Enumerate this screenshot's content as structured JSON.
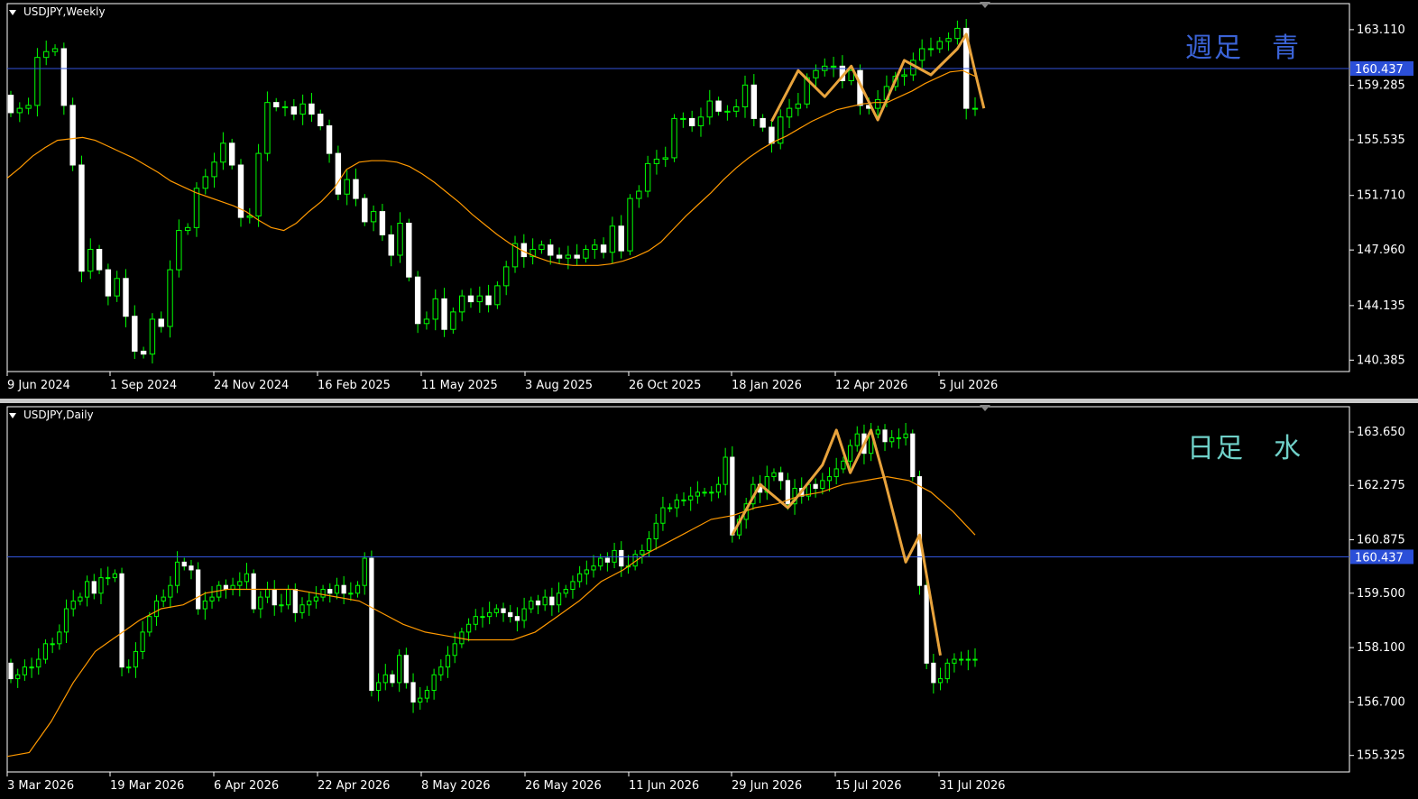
{
  "colors": {
    "background": "#000000",
    "grid_frame": "#ffffff",
    "candle_bull": "#00ff00",
    "candle_bear": "#ffffff",
    "ma": "#ff9900",
    "hline": "#3355dd",
    "pattern": "#e8a33c",
    "label_weekly": "#3b63d6",
    "label_daily": "#6fd0c8"
  },
  "weekly": {
    "title": "USDJPY,Weekly",
    "annotation": "週足　青",
    "hline_label": "160.437",
    "x_labels": [
      "9 Jun 2024",
      "1 Sep 2024",
      "24 Nov 2024",
      "16 Feb 2025",
      "11 May 2025",
      "3 Aug 2025",
      "26 Oct 2025",
      "18 Jan 2026",
      "12 Apr 2026",
      "5 Jul 2026"
    ],
    "y_labels": [
      "163.110",
      "159.285",
      "155.535",
      "151.710",
      "147.960",
      "144.135",
      "140.385"
    ]
  },
  "daily": {
    "title": "USDJPY,Daily",
    "annotation": "日足　水",
    "hline_label": "160.437",
    "x_labels": [
      "3 Mar 2026",
      "19 Mar 2026",
      "6 Apr 2026",
      "22 Apr 2026",
      "8 May 2026",
      "26 May 2026",
      "11 Jun 2026",
      "29 Jun 2026",
      "15 Jul 2026",
      "31 Jul 2026"
    ],
    "y_labels": [
      "163.650",
      "162.275",
      "160.875",
      "159.500",
      "158.100",
      "156.700",
      "155.325"
    ]
  },
  "chart_data": [
    {
      "type": "candlestick",
      "title": "USDJPY,Weekly",
      "ylim": [
        139.6,
        164.9
      ],
      "hline": 160.437,
      "x_start": "9 Jun 2024",
      "x_end": "5 Jul 2026",
      "close": [
        157.4,
        157.7,
        157.9,
        161.2,
        161.6,
        161.8,
        157.9,
        153.8,
        146.5,
        148.0,
        146.6,
        144.8,
        146.0,
        143.4,
        141.0,
        140.8,
        143.2,
        142.7,
        146.6,
        149.3,
        149.5,
        152.2,
        153.0,
        154.0,
        155.3,
        153.8,
        150.2,
        150.3,
        154.6,
        158.1,
        157.8,
        157.8,
        157.3,
        158.0,
        157.3,
        156.5,
        154.6,
        151.8,
        152.8,
        151.5,
        149.9,
        150.6,
        149.0,
        147.6,
        149.8,
        146.1,
        142.9,
        143.2,
        144.6,
        142.5,
        143.7,
        144.8,
        144.4,
        144.8,
        144.2,
        145.5,
        146.8,
        148.4,
        147.5,
        148.0,
        148.3,
        147.6,
        147.4,
        147.6,
        147.4,
        148.0,
        148.3,
        147.8,
        149.6,
        147.9,
        151.5,
        152.0,
        153.9,
        154.2,
        154.3,
        157.0,
        157.0,
        156.5,
        157.1,
        158.2,
        157.5,
        157.5,
        157.8,
        159.3,
        157.0,
        156.4,
        155.3,
        157.1,
        157.7,
        158.0,
        159.8,
        160.3,
        160.6,
        160.6,
        159.6,
        160.3,
        157.9,
        157.7,
        158.3,
        159.2,
        159.9,
        160.0,
        161.0,
        161.8,
        161.8,
        162.3,
        162.5,
        163.2,
        157.7,
        157.7
      ],
      "open": [
        158.6,
        157.4,
        157.7,
        157.9,
        161.2,
        161.6,
        161.8,
        157.9,
        153.8,
        146.5,
        148.0,
        146.6,
        144.8,
        146.0,
        143.4,
        141.0,
        140.8,
        143.2,
        142.7,
        146.6,
        149.3,
        149.5,
        152.2,
        153.0,
        154.0,
        155.3,
        153.8,
        150.2,
        150.3,
        154.6,
        158.1,
        157.8,
        157.8,
        157.3,
        158.0,
        157.3,
        156.5,
        154.6,
        151.8,
        152.8,
        151.5,
        149.9,
        150.6,
        149.0,
        147.6,
        149.8,
        146.1,
        142.9,
        143.2,
        144.6,
        142.5,
        143.7,
        144.8,
        144.4,
        144.8,
        144.2,
        145.5,
        146.8,
        148.4,
        147.5,
        148.0,
        148.3,
        147.6,
        147.4,
        147.6,
        147.4,
        148.0,
        148.3,
        147.8,
        149.6,
        147.9,
        151.5,
        152.0,
        153.9,
        154.2,
        154.3,
        157.0,
        157.0,
        156.5,
        157.1,
        158.2,
        157.5,
        157.5,
        157.8,
        159.3,
        157.0,
        156.4,
        155.3,
        157.1,
        157.7,
        158.0,
        159.8,
        160.3,
        160.6,
        160.6,
        159.6,
        160.3,
        157.9,
        157.7,
        158.3,
        159.2,
        159.9,
        160.0,
        161.0,
        161.8,
        161.8,
        162.3,
        162.5,
        163.2,
        157.7
      ],
      "ma": [
        152.9,
        153.6,
        154.4,
        155.0,
        155.5,
        155.6,
        155.7,
        155.5,
        155.1,
        154.7,
        154.3,
        153.8,
        153.3,
        152.7,
        152.3,
        151.9,
        151.6,
        151.3,
        151.0,
        150.6,
        150.0,
        149.5,
        149.3,
        149.8,
        150.6,
        151.3,
        152.2,
        153.5,
        154.0,
        154.1,
        154.1,
        154.0,
        153.7,
        153.2,
        152.6,
        151.9,
        151.2,
        150.4,
        149.7,
        149.0,
        148.4,
        147.9,
        147.5,
        147.2,
        147.0,
        146.9,
        146.9,
        146.9,
        147.0,
        147.2,
        147.5,
        147.9,
        148.5,
        149.4,
        150.3,
        151.1,
        151.9,
        152.8,
        153.6,
        154.3,
        154.9,
        155.4,
        155.8,
        156.3,
        156.8,
        157.2,
        157.6,
        157.8,
        158.0,
        158.1,
        158.1,
        158.5,
        158.9,
        159.4,
        159.8,
        160.2,
        160.3,
        159.9
      ]
    },
    {
      "type": "candlestick",
      "title": "USDJPY,Daily",
      "ylim": [
        154.9,
        164.3
      ],
      "hline": 160.437,
      "x_start": "3 Mar 2026",
      "x_end": "31 Jul 2026",
      "close": [
        157.3,
        157.4,
        157.6,
        157.6,
        157.8,
        158.2,
        158.2,
        158.5,
        159.1,
        159.3,
        159.4,
        159.8,
        159.5,
        159.9,
        159.9,
        160.0,
        157.6,
        157.6,
        158.0,
        158.5,
        158.9,
        159.3,
        159.4,
        159.7,
        160.3,
        160.2,
        160.1,
        159.1,
        159.3,
        159.4,
        159.7,
        159.6,
        159.7,
        159.8,
        160.0,
        159.1,
        159.4,
        159.6,
        159.2,
        159.2,
        159.6,
        159.0,
        159.2,
        159.3,
        159.4,
        159.6,
        159.5,
        159.7,
        159.5,
        159.5,
        159.7,
        160.4,
        157.0,
        157.2,
        157.4,
        157.2,
        157.9,
        157.2,
        156.7,
        156.8,
        157.0,
        157.4,
        157.6,
        157.9,
        158.2,
        158.5,
        158.7,
        158.9,
        158.9,
        159.0,
        159.1,
        159.0,
        158.9,
        158.8,
        159.1,
        159.3,
        159.2,
        159.4,
        159.2,
        159.5,
        159.6,
        159.8,
        160.0,
        160.1,
        160.2,
        160.4,
        160.3,
        160.6,
        160.2,
        160.2,
        160.5,
        160.6,
        160.9,
        161.3,
        161.7,
        161.7,
        161.9,
        161.9,
        162.0,
        162.1,
        162.1,
        162.1,
        162.3,
        163.0,
        161.0,
        161.4,
        161.8,
        162.3,
        162.1,
        162.5,
        162.6,
        162.4,
        161.8,
        162.2,
        162.0,
        162.3,
        162.2,
        162.4,
        162.5,
        162.7,
        162.9,
        163.3,
        163.6,
        163.1,
        163.6,
        163.7,
        163.4,
        163.5,
        163.5,
        163.6,
        162.5,
        159.7,
        157.7,
        157.2,
        157.3,
        157.7,
        157.8,
        157.8,
        157.8,
        157.8
      ],
      "open": [
        157.7,
        157.3,
        157.4,
        157.6,
        157.6,
        157.8,
        158.2,
        158.2,
        158.5,
        159.1,
        159.3,
        159.4,
        159.8,
        159.5,
        159.9,
        159.9,
        160.0,
        157.6,
        157.6,
        158.0,
        158.5,
        158.9,
        159.3,
        159.4,
        159.7,
        160.3,
        160.2,
        160.1,
        159.1,
        159.3,
        159.4,
        159.7,
        159.6,
        159.7,
        159.8,
        160.0,
        159.1,
        159.4,
        159.6,
        159.2,
        159.2,
        159.6,
        159.0,
        159.2,
        159.3,
        159.4,
        159.6,
        159.5,
        159.7,
        159.5,
        159.5,
        159.7,
        160.4,
        157.0,
        157.2,
        157.4,
        157.2,
        157.9,
        157.2,
        156.7,
        156.8,
        157.0,
        157.4,
        157.6,
        157.9,
        158.2,
        158.5,
        158.7,
        158.9,
        158.9,
        159.0,
        159.1,
        159.0,
        158.9,
        158.8,
        159.1,
        159.3,
        159.2,
        159.4,
        159.2,
        159.5,
        159.6,
        159.8,
        160.0,
        160.1,
        160.2,
        160.4,
        160.3,
        160.6,
        160.2,
        160.2,
        160.5,
        160.6,
        160.9,
        161.3,
        161.7,
        161.7,
        161.9,
        161.9,
        162.0,
        162.1,
        162.1,
        162.1,
        162.3,
        163.0,
        161.0,
        161.4,
        161.8,
        162.3,
        162.1,
        162.5,
        162.6,
        162.4,
        161.8,
        162.2,
        162.0,
        162.3,
        162.2,
        162.4,
        162.5,
        162.7,
        162.9,
        163.3,
        163.6,
        163.1,
        163.6,
        163.7,
        163.4,
        163.5,
        163.5,
        163.6,
        162.5,
        159.7,
        157.7,
        157.2,
        157.3,
        157.7,
        157.8,
        157.8,
        157.8
      ],
      "ma": [
        155.3,
        155.4,
        156.2,
        157.2,
        158.0,
        158.4,
        158.8,
        159.1,
        159.2,
        159.5,
        159.6,
        159.6,
        159.6,
        159.6,
        159.5,
        159.4,
        159.3,
        159.0,
        158.7,
        158.5,
        158.4,
        158.3,
        158.3,
        158.3,
        158.5,
        158.9,
        159.3,
        159.8,
        160.1,
        160.5,
        160.8,
        161.1,
        161.4,
        161.5,
        161.7,
        161.8,
        162.0,
        162.1,
        162.3,
        162.4,
        162.5,
        162.4,
        162.1,
        161.6,
        161.0
      ],
      "pattern_note": "orange zigzag annotation drawn over candles"
    }
  ]
}
